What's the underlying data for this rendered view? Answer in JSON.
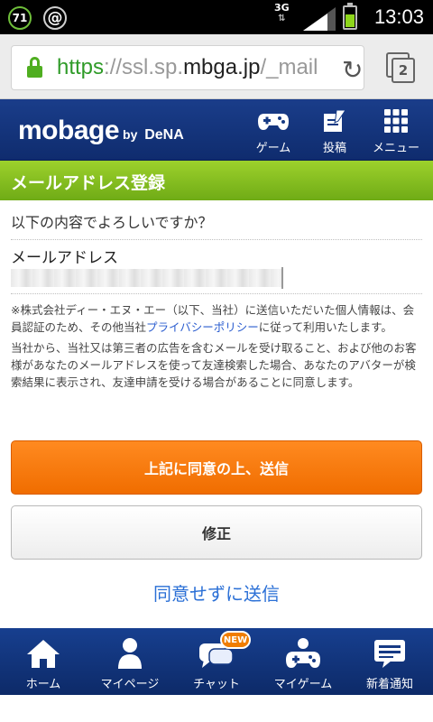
{
  "status_bar": {
    "notification_count": "71",
    "notification_symbol": "@",
    "network": "3G",
    "network_arrows": "⇅",
    "time": "13:03"
  },
  "browser": {
    "url_scheme": "https",
    "url_separator": "://",
    "url_subdomain": "ssl.sp.",
    "url_domain": "mbga.jp",
    "url_path": "/_mail",
    "tab_count": "2",
    "reload_glyph": "↻"
  },
  "header": {
    "logo_text": "mobage",
    "logo_by": "by",
    "logo_dena": "DeNA",
    "nav": [
      {
        "label": "ゲーム",
        "icon": "gamepad-icon"
      },
      {
        "label": "投稿",
        "icon": "post-icon"
      },
      {
        "label": "メニュー",
        "icon": "grid-menu-icon"
      }
    ]
  },
  "page": {
    "title": "メールアドレス登録",
    "question": "以下の内容でよろしいですか？",
    "field_label": "メールアドレス",
    "note_part1": "※株式会社ディー・エヌ・エー（以下、当社）に送信いただいた個人情報は、会員認証のため、その他当社",
    "note_link": "プライバシーポリシー",
    "note_part2": "に従って利用いたします。",
    "note_para2": "当社から、当社又は第三者の広告を含むメールを受け取ること、および他のお客様があなたのメールアドレスを使って友達検索した場合、あなたのアバターが検索結果に表示され、友達申請を受ける場合があることに同意します。",
    "agree_button": "上記に同意の上、送信",
    "edit_button": "修正",
    "decline_link": "同意せずに送信"
  },
  "bottom_nav": [
    {
      "label": "ホーム",
      "icon": "home-icon"
    },
    {
      "label": "マイページ",
      "icon": "person-icon"
    },
    {
      "label": "チャット",
      "icon": "chat-icon",
      "badge": "NEW"
    },
    {
      "label": "マイゲーム",
      "icon": "mygame-icon"
    },
    {
      "label": "新着通知",
      "icon": "notification-icon"
    }
  ],
  "colors": {
    "header_blue": "#163a84",
    "title_green": "#8bc425",
    "primary_orange": "#f77a10",
    "link_blue": "#2a6fd6",
    "url_green": "#2f9b28"
  }
}
